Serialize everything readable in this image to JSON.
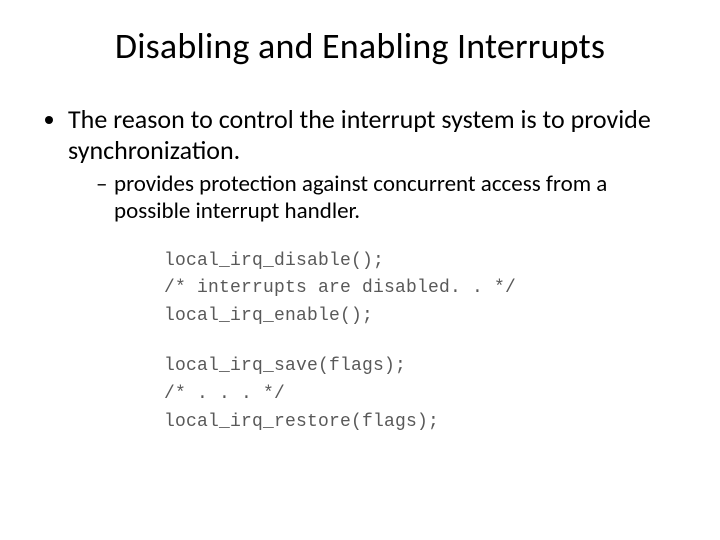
{
  "title": "Disabling and Enabling Interrupts",
  "bullet": "The reason to control the interrupt system is to provide synchronization.",
  "sub": "provides protection against concurrent access from a possible interrupt handler.",
  "code": {
    "l1": "local_irq_disable();",
    "l2": "/* interrupts are disabled. . */",
    "l3": "local_irq_enable();",
    "l4": "local_irq_save(flags);",
    "l5": "/* . . . */",
    "l6": "local_irq_restore(flags);"
  }
}
